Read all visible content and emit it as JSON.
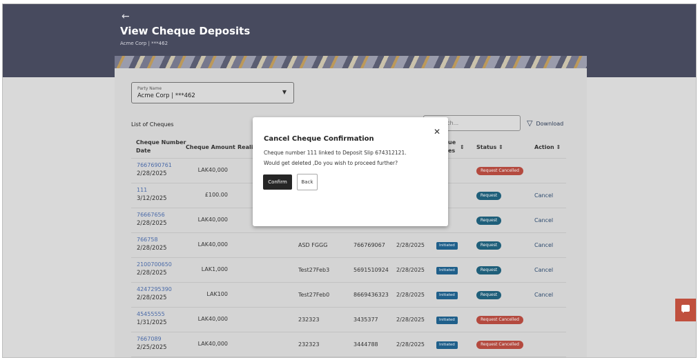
{
  "header": {
    "back_icon": "arrow-left-icon",
    "title": "View Cheque Deposits",
    "subtitle": "Acme Corp | ***462",
    "bg_color": "#474a5e"
  },
  "party_select": {
    "label": "Party Name",
    "value": "Acme Corp | ***462"
  },
  "list": {
    "title": "List of Cheques",
    "search_placeholder": "rch...",
    "download_label": "Download",
    "columns": {
      "cheque_number_line1": "Cheque Number",
      "cheque_number_line2": "Date",
      "cheque_amount": "Cheque Amount",
      "realised": "Realis",
      "type_fragment_1": "ue",
      "type_fragment_2": "es",
      "status": "Status",
      "action": "Action"
    },
    "rows": [
      {
        "number": "7667690761",
        "date": "2/28/2025",
        "amount": "LAK40,000",
        "status": "Request Cancelled",
        "action": ""
      },
      {
        "number": "111",
        "date": "3/12/2025",
        "amount": "£100.00",
        "status": "Request",
        "action": "Cancel"
      },
      {
        "number": "76667656",
        "date": "2/28/2025",
        "amount": "LAK40,000",
        "status": "Request",
        "action": "Cancel"
      },
      {
        "number": "766758",
        "date": "2/28/2025",
        "amount": "LAK40,000",
        "slip_ref": "ASD FGGG",
        "deposit_no": "766769067",
        "deposit_date": "2/28/2025",
        "badge": "Initiated",
        "status": "Request",
        "action": "Cancel"
      },
      {
        "number": "2100700650",
        "date": "2/28/2025",
        "amount": "LAK1,000",
        "slip_ref": "Test27Feb3",
        "deposit_no": "5691510924",
        "deposit_date": "2/28/2025",
        "badge": "Initiated",
        "status": "Request",
        "action": "Cancel"
      },
      {
        "number": "4247295390",
        "date": "2/28/2025",
        "amount": "LAK100",
        "slip_ref": "Test27Feb0",
        "deposit_no": "8669436323",
        "deposit_date": "2/28/2025",
        "badge": "Initiated",
        "status": "Request",
        "action": "Cancel"
      },
      {
        "number": "45455555",
        "date": "1/31/2025",
        "amount": "LAK40,000",
        "slip_ref": "232323",
        "deposit_no": "3435377",
        "deposit_date": "2/28/2025",
        "badge": "Initiated",
        "status": "Request Cancelled",
        "action": ""
      },
      {
        "number": "7667089",
        "date": "2/25/2025",
        "amount": "LAK40,000",
        "slip_ref": "232323",
        "deposit_no": "3444788",
        "deposit_date": "2/28/2025",
        "badge": "Initiated",
        "status": "Request Cancelled",
        "action": ""
      }
    ]
  },
  "modal": {
    "title": "Cancel Cheque Confirmation",
    "line1": "Cheque number 111 linked to Deposit Slip 674312121.",
    "line2": "Would get deleted ,Do you wish to proceed further?",
    "confirm_label": "Confirm",
    "back_label": "Back",
    "close_glyph": "✕"
  },
  "colors": {
    "cancelled": "#b44a3f",
    "request": "#1f5f7a",
    "initiated": "#1f5f8a",
    "chat": "#c0503e"
  },
  "icons": {
    "sort": "sort-icon",
    "caret": "chevron-down-icon",
    "filter": "filter-icon",
    "chat": "chat-icon"
  }
}
